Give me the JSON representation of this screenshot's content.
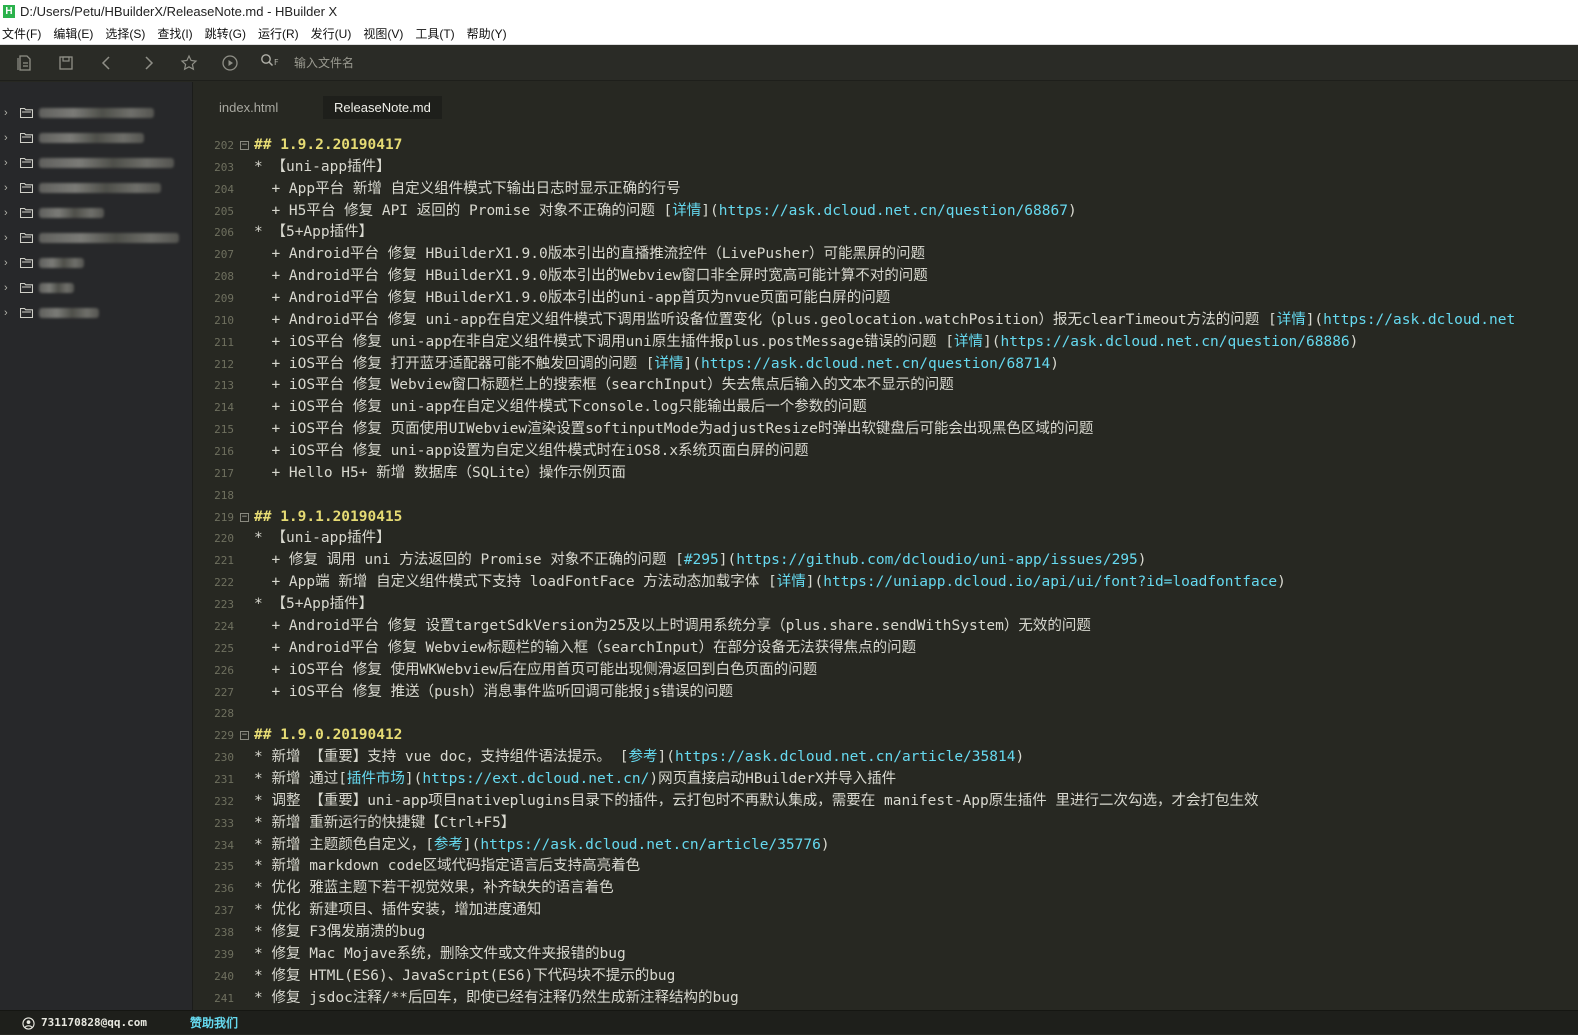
{
  "window": {
    "title": "D:/Users/Petu/HBuilderX/ReleaseNote.md - HBuilder X",
    "logo_glyph": "H"
  },
  "menu": [
    "文件(F)",
    "编辑(E)",
    "选择(S)",
    "查找(I)",
    "跳转(G)",
    "运行(R)",
    "发行(U)",
    "视图(V)",
    "工具(T)",
    "帮助(Y)"
  ],
  "toolbar": {
    "icons": [
      "new-file-icon",
      "save-icon",
      "back-icon",
      "forward-icon",
      "bookmark-star-icon",
      "run-icon",
      "file-search-icon"
    ],
    "search_placeholder": "输入文件名"
  },
  "sidebar": {
    "items_count_note": "9 collapsed project folders with blurred names",
    "items": [
      "",
      "",
      "",
      "",
      "",
      "",
      "",
      "",
      ""
    ]
  },
  "tabs": [
    {
      "label": "index.html",
      "active": false
    },
    {
      "label": "ReleaseNote.md",
      "active": true
    }
  ],
  "colors": {
    "editor_bg": "#272822",
    "heading": "#e6db74",
    "link": "#66d9ef",
    "text": "#d8d8cf"
  },
  "lines": [
    {
      "n": "202",
      "fold": true,
      "segs": [
        [
          "hd",
          "## 1.9.2.20190417"
        ]
      ]
    },
    {
      "n": "203",
      "segs": [
        [
          "",
          "* 【uni-app插件】"
        ]
      ]
    },
    {
      "n": "204",
      "segs": [
        [
          "",
          "  + App平台 新增 自定义组件模式下输出日志时显示正确的行号"
        ]
      ]
    },
    {
      "n": "205",
      "segs": [
        [
          "",
          "  + H5平台 修复 API 返回的 Promise 对象不正确的问题 ["
        ],
        [
          "md-link",
          "详情"
        ],
        [
          "",
          "]("
        ],
        [
          "md-url",
          "https://ask.dcloud.net.cn/question/68867"
        ],
        [
          "",
          ")"
        ]
      ]
    },
    {
      "n": "206",
      "segs": [
        [
          "",
          "* 【5+App插件】"
        ]
      ]
    },
    {
      "n": "207",
      "segs": [
        [
          "",
          "  + Android平台 修复 HBuilderX1.9.0版本引出的直播推流控件（LivePusher）可能黑屏的问题"
        ]
      ]
    },
    {
      "n": "208",
      "segs": [
        [
          "",
          "  + Android平台 修复 HBuilderX1.9.0版本引出的Webview窗口非全屏时宽高可能计算不对的问题"
        ]
      ]
    },
    {
      "n": "209",
      "segs": [
        [
          "",
          "  + Android平台 修复 HBuilderX1.9.0版本引出的uni-app首页为nvue页面可能白屏的问题"
        ]
      ]
    },
    {
      "n": "210",
      "segs": [
        [
          "",
          "  + Android平台 修复 uni-app在自定义组件模式下调用监听设备位置变化（plus.geolocation.watchPosition）报无clearTimeout方法的问题 ["
        ],
        [
          "md-link",
          "详情"
        ],
        [
          "",
          "]("
        ],
        [
          "md-url",
          "https://ask.dcloud.net"
        ]
      ]
    },
    {
      "n": "211",
      "segs": [
        [
          "",
          "  + iOS平台 修复 uni-app在非自定义组件模式下调用uni原生插件报plus.postMessage错误的问题 ["
        ],
        [
          "md-link",
          "详情"
        ],
        [
          "",
          "]("
        ],
        [
          "md-url",
          "https://ask.dcloud.net.cn/question/68886"
        ],
        [
          "",
          ")"
        ]
      ]
    },
    {
      "n": "212",
      "segs": [
        [
          "",
          "  + iOS平台 修复 打开蓝牙适配器可能不触发回调的问题 ["
        ],
        [
          "md-link",
          "详情"
        ],
        [
          "",
          "]("
        ],
        [
          "md-url",
          "https://ask.dcloud.net.cn/question/68714"
        ],
        [
          "",
          ")"
        ]
      ]
    },
    {
      "n": "213",
      "segs": [
        [
          "",
          "  + iOS平台 修复 Webview窗口标题栏上的搜索框（searchInput）失去焦点后输入的文本不显示的问题"
        ]
      ]
    },
    {
      "n": "214",
      "segs": [
        [
          "",
          "  + iOS平台 修复 uni-app在自定义组件模式下console.log只能输出最后一个参数的问题"
        ]
      ]
    },
    {
      "n": "215",
      "segs": [
        [
          "",
          "  + iOS平台 修复 页面使用UIWebview渲染设置softinputMode为adjustResize时弹出软键盘后可能会出现黑色区域的问题"
        ]
      ]
    },
    {
      "n": "216",
      "segs": [
        [
          "",
          "  + iOS平台 修复 uni-app设置为自定义组件模式时在iOS8.x系统页面白屏的问题"
        ]
      ]
    },
    {
      "n": "217",
      "segs": [
        [
          "",
          "  + Hello H5+ 新增 数据库（SQLite）操作示例页面"
        ]
      ]
    },
    {
      "n": "218",
      "segs": [
        [
          "",
          ""
        ]
      ]
    },
    {
      "n": "219",
      "fold": true,
      "segs": [
        [
          "hd",
          "## 1.9.1.20190415"
        ]
      ]
    },
    {
      "n": "220",
      "segs": [
        [
          "",
          "* 【uni-app插件】"
        ]
      ]
    },
    {
      "n": "221",
      "segs": [
        [
          "",
          "  + 修复 调用 uni 方法返回的 Promise 对象不正确的问题 ["
        ],
        [
          "md-link",
          "#295"
        ],
        [
          "",
          "]("
        ],
        [
          "md-url",
          "https://github.com/dcloudio/uni-app/issues/295"
        ],
        [
          "",
          ")"
        ]
      ]
    },
    {
      "n": "222",
      "segs": [
        [
          "",
          "  + App端 新增 自定义组件模式下支持 loadFontFace 方法动态加载字体 ["
        ],
        [
          "md-link",
          "详情"
        ],
        [
          "",
          "]("
        ],
        [
          "md-url",
          "https://uniapp.dcloud.io/api/ui/font?id=loadfontface"
        ],
        [
          "",
          ")"
        ]
      ]
    },
    {
      "n": "223",
      "segs": [
        [
          "",
          "* 【5+App插件】"
        ]
      ]
    },
    {
      "n": "224",
      "segs": [
        [
          "",
          "  + Android平台 修复 设置targetSdkVersion为25及以上时调用系统分享（plus.share.sendWithSystem）无效的问题"
        ]
      ]
    },
    {
      "n": "225",
      "segs": [
        [
          "",
          "  + Android平台 修复 Webview标题栏的输入框（searchInput）在部分设备无法获得焦点的问题"
        ]
      ]
    },
    {
      "n": "226",
      "segs": [
        [
          "",
          "  + iOS平台 修复 使用WKWebview后在应用首页可能出现侧滑返回到白色页面的问题"
        ]
      ]
    },
    {
      "n": "227",
      "segs": [
        [
          "",
          "  + iOS平台 修复 推送（push）消息事件监听回调可能报js错误的问题"
        ]
      ]
    },
    {
      "n": "228",
      "segs": [
        [
          "",
          ""
        ]
      ]
    },
    {
      "n": "229",
      "fold": true,
      "segs": [
        [
          "hd",
          "## 1.9.0.20190412"
        ]
      ]
    },
    {
      "n": "230",
      "segs": [
        [
          "",
          "* 新增 【重要】支持 vue doc，支持组件语法提示。 ["
        ],
        [
          "md-link",
          "参考"
        ],
        [
          "",
          "]("
        ],
        [
          "md-url",
          "https://ask.dcloud.net.cn/article/35814"
        ],
        [
          "",
          ")"
        ]
      ]
    },
    {
      "n": "231",
      "segs": [
        [
          "",
          "* 新增 通过["
        ],
        [
          "md-link",
          "插件市场"
        ],
        [
          "",
          "]("
        ],
        [
          "md-url",
          "https://ext.dcloud.net.cn/"
        ],
        [
          "",
          ")网页直接启动HBuilderX并导入插件"
        ]
      ]
    },
    {
      "n": "232",
      "segs": [
        [
          "",
          "* 调整 【重要】uni-app项目nativeplugins目录下的插件，云打包时不再默认集成，需要在 manifest-App原生插件 里进行二次勾选，才会打包生效"
        ]
      ]
    },
    {
      "n": "233",
      "segs": [
        [
          "",
          "* 新增 重新运行的快捷键【Ctrl+F5】"
        ]
      ]
    },
    {
      "n": "234",
      "segs": [
        [
          "",
          "* 新增 主题颜色自定义，["
        ],
        [
          "md-link",
          "参考"
        ],
        [
          "",
          "]("
        ],
        [
          "md-url",
          "https://ask.dcloud.net.cn/article/35776"
        ],
        [
          "",
          ")"
        ]
      ]
    },
    {
      "n": "235",
      "segs": [
        [
          "",
          "* 新增 markdown code区域代码指定语言后支持高亮着色"
        ]
      ]
    },
    {
      "n": "236",
      "segs": [
        [
          "",
          "* 优化 雅蓝主题下若干视觉效果，补齐缺失的语言着色"
        ]
      ]
    },
    {
      "n": "237",
      "segs": [
        [
          "",
          "* 优化 新建项目、插件安装，增加进度通知"
        ]
      ]
    },
    {
      "n": "238",
      "segs": [
        [
          "",
          "* 修复 F3偶发崩溃的bug"
        ]
      ]
    },
    {
      "n": "239",
      "segs": [
        [
          "",
          "* 修复 Mac Mojave系统，删除文件或文件夹报错的bug"
        ]
      ]
    },
    {
      "n": "240",
      "segs": [
        [
          "",
          "* 修复 HTML(ES6)、JavaScript(ES6)下代码块不提示的bug"
        ]
      ]
    },
    {
      "n": "241",
      "segs": [
        [
          "",
          "* 修复 jsdoc注释/**后回车，即使已经有注释仍然生成新注释结构的bug"
        ]
      ]
    }
  ],
  "status": {
    "user": "731170828@qq.com",
    "help_label": "赞助我们"
  }
}
